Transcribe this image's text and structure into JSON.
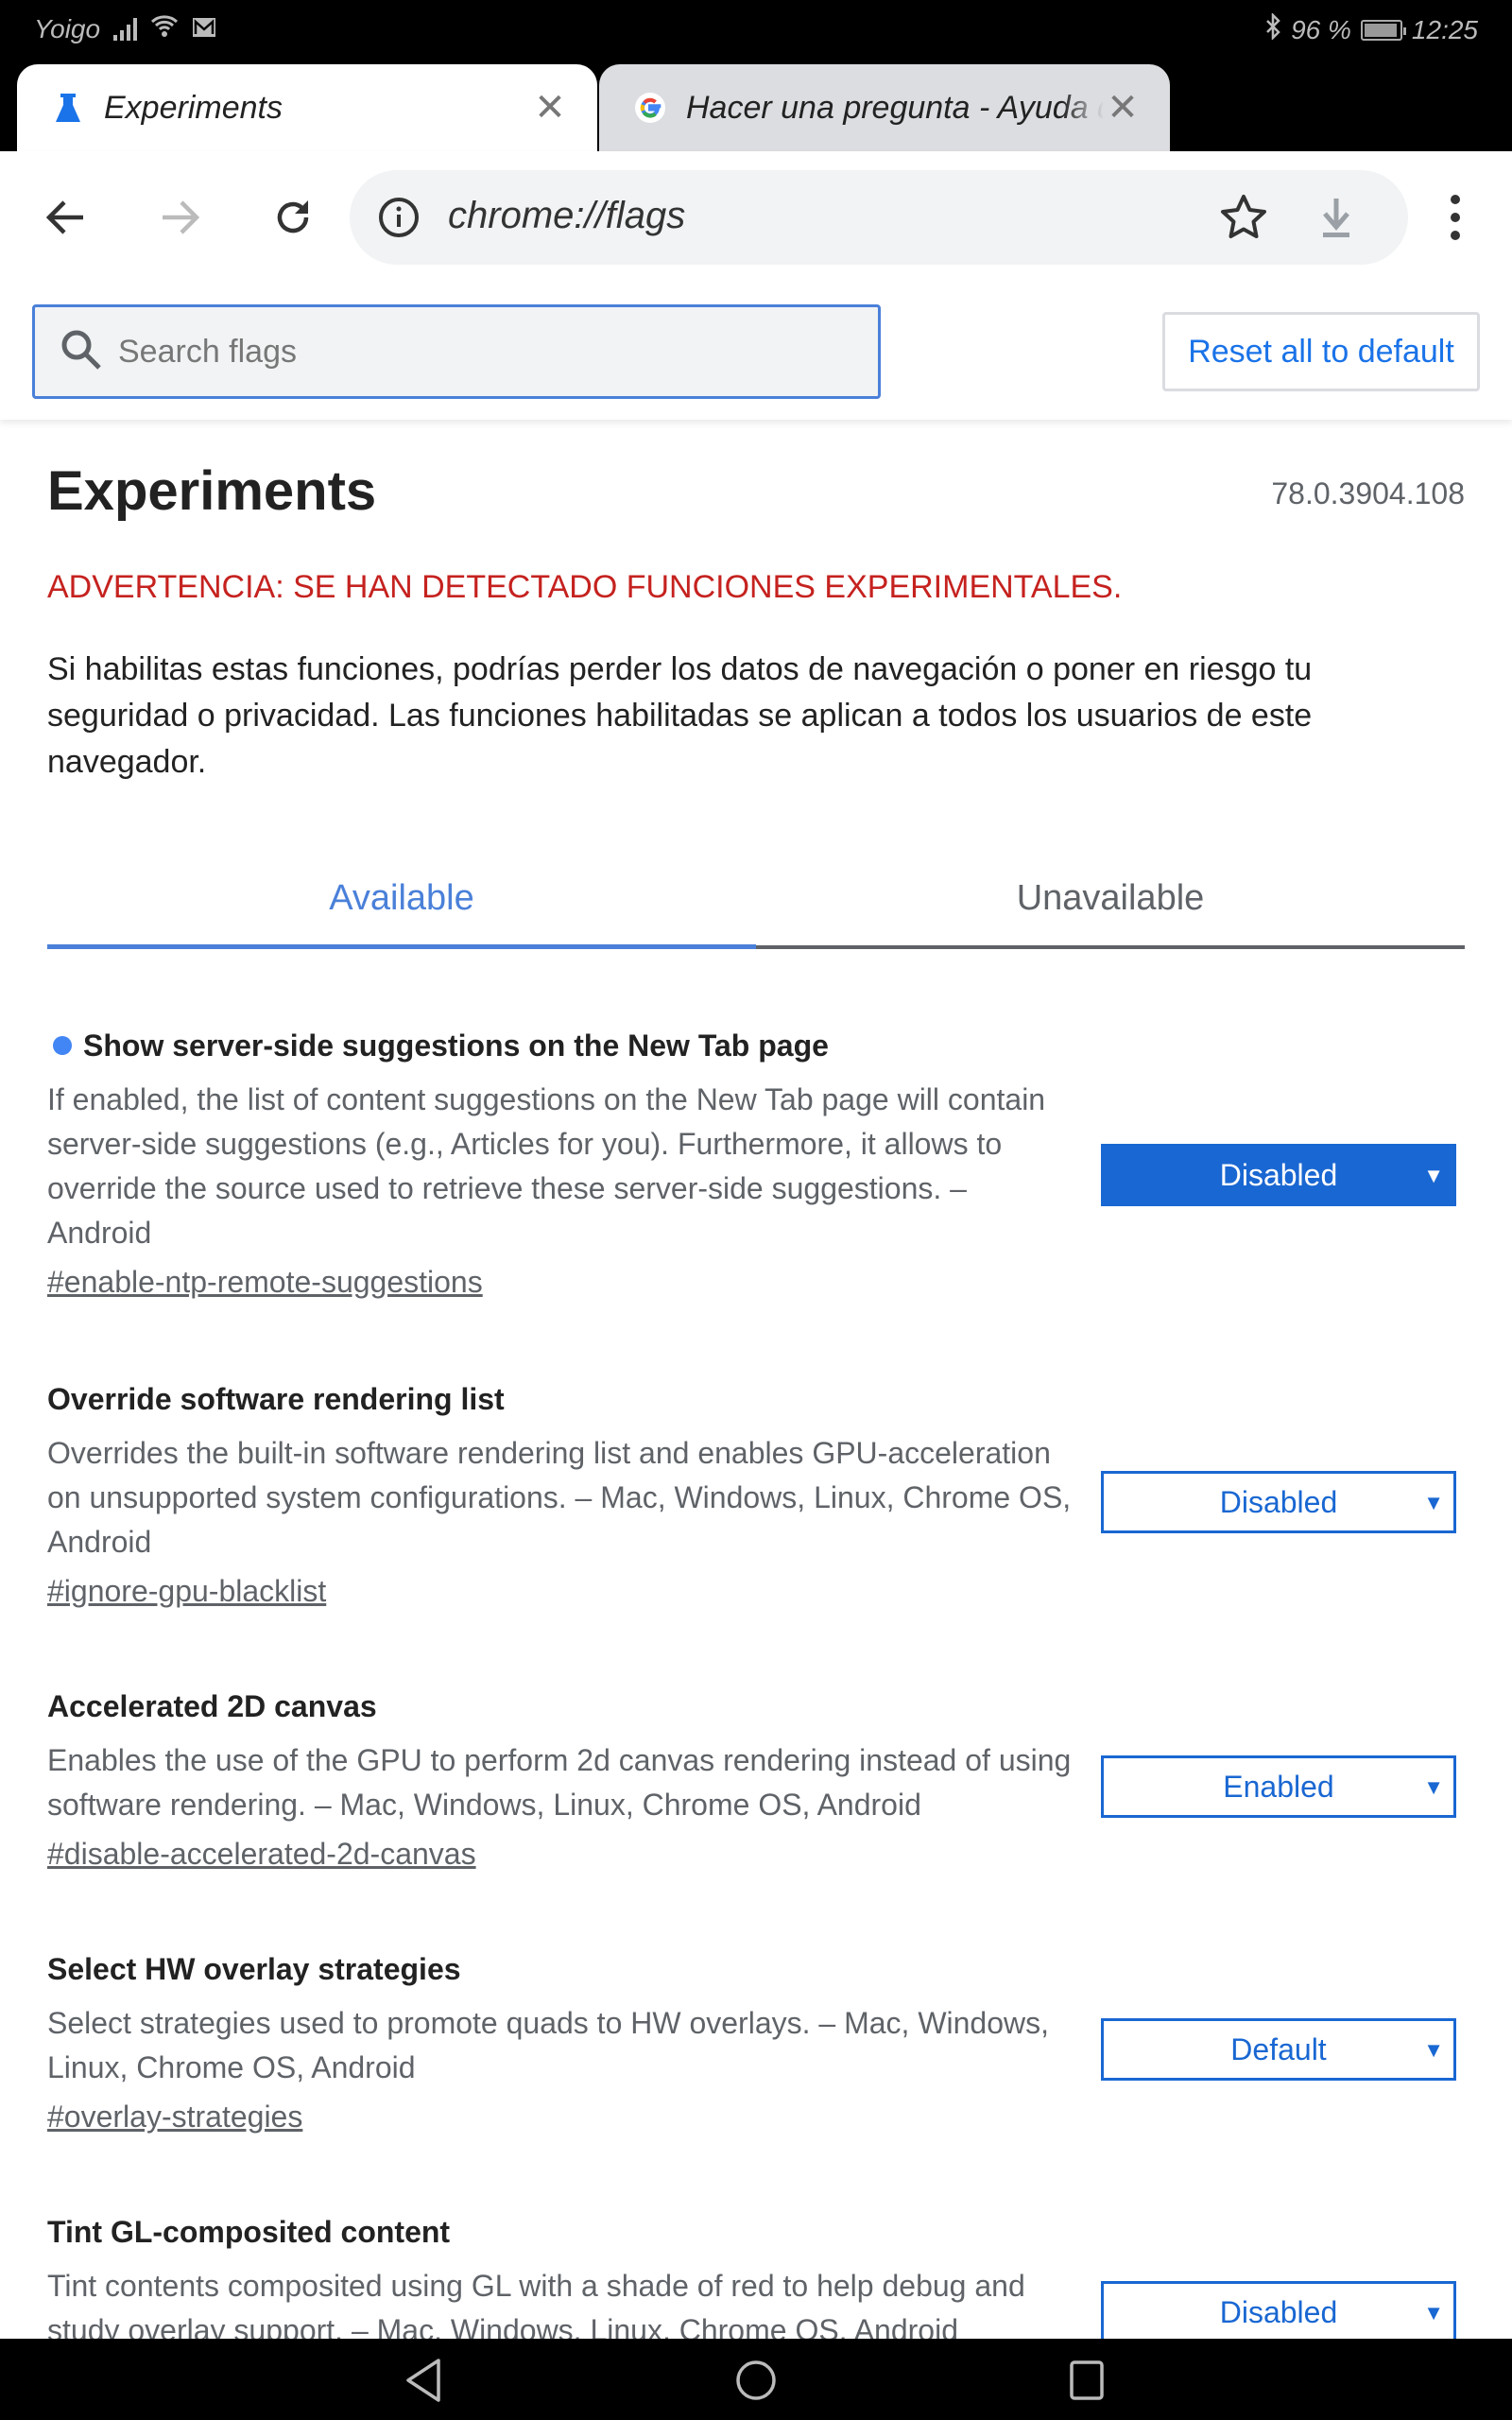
{
  "status_bar": {
    "carrier": "Yoigo",
    "battery_percent": "96 %",
    "time": "12:25"
  },
  "tabs": [
    {
      "title": "Experiments",
      "icon": "flask-icon",
      "active": true
    },
    {
      "title": "Hacer una pregunta - Ayuda de Google",
      "icon": "google-icon",
      "active": false
    }
  ],
  "toolbar": {
    "url": "chrome://flags"
  },
  "search": {
    "placeholder": "Search flags",
    "value": ""
  },
  "reset_button": "Reset all to default",
  "page": {
    "title": "Experiments",
    "version": "78.0.3904.108",
    "warning": "ADVERTENCIA: SE HAN DETECTADO FUNCIONES EXPERIMENTALES.",
    "intro": "Si habilitas estas funciones, podrías perder los datos de navegación o poner en riesgo tu seguridad o privacidad. Las funciones habilitadas se aplican a todos los usuarios de este navegador."
  },
  "content_tabs": [
    {
      "label": "Available",
      "selected": true
    },
    {
      "label": "Unavailable",
      "selected": false
    }
  ],
  "flags": [
    {
      "name": "Show server-side suggestions on the New Tab page",
      "modified": true,
      "description": "If enabled, the list of content suggestions on the New Tab page will contain server-side suggestions (e.g., Articles for you). Furthermore, it allows to override the source used to retrieve these server-side suggestions. – Android",
      "link": "#enable-ntp-remote-suggestions",
      "value": "Disabled"
    },
    {
      "name": "Override software rendering list",
      "modified": false,
      "description": "Overrides the built-in software rendering list and enables GPU-acceleration on unsupported system configurations. – Mac, Windows, Linux, Chrome OS, Android",
      "link": "#ignore-gpu-blacklist",
      "value": "Disabled"
    },
    {
      "name": "Accelerated 2D canvas",
      "modified": false,
      "description": "Enables the use of the GPU to perform 2d canvas rendering instead of using software rendering. – Mac, Windows, Linux, Chrome OS, Android",
      "link": "#disable-accelerated-2d-canvas",
      "value": "Enabled"
    },
    {
      "name": "Select HW overlay strategies",
      "modified": false,
      "description": "Select strategies used to promote quads to HW overlays. – Mac, Windows, Linux, Chrome OS, Android",
      "link": "#overlay-strategies",
      "value": "Default"
    },
    {
      "name": "Tint GL-composited content",
      "modified": false,
      "description": "Tint contents composited using GL with a shade of red to help debug and study overlay support. – Mac, Windows, Linux, Chrome OS, Android",
      "link": "",
      "value": "Disabled"
    }
  ],
  "colors": {
    "accent": "#1967d2",
    "tab_blue": "#4a80d9",
    "warning_red": "#c5221f",
    "modified_dot": "#4285f4"
  }
}
